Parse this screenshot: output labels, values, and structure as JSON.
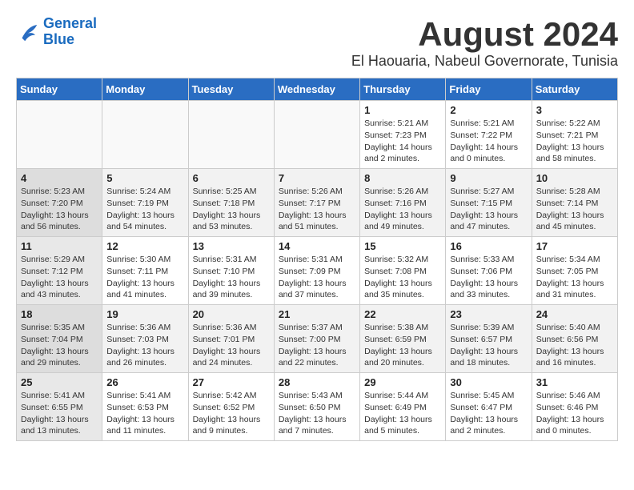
{
  "header": {
    "logo_line1": "General",
    "logo_line2": "Blue",
    "main_title": "August 2024",
    "subtitle": "El Haouaria, Nabeul Governorate, Tunisia"
  },
  "calendar": {
    "days_of_week": [
      "Sunday",
      "Monday",
      "Tuesday",
      "Wednesday",
      "Thursday",
      "Friday",
      "Saturday"
    ],
    "weeks": [
      {
        "days": [
          {
            "number": "",
            "content": ""
          },
          {
            "number": "",
            "content": ""
          },
          {
            "number": "",
            "content": ""
          },
          {
            "number": "",
            "content": ""
          },
          {
            "number": "1",
            "content": "Sunrise: 5:21 AM\nSunset: 7:23 PM\nDaylight: 14 hours\nand 2 minutes."
          },
          {
            "number": "2",
            "content": "Sunrise: 5:21 AM\nSunset: 7:22 PM\nDaylight: 14 hours\nand 0 minutes."
          },
          {
            "number": "3",
            "content": "Sunrise: 5:22 AM\nSunset: 7:21 PM\nDaylight: 13 hours\nand 58 minutes."
          }
        ]
      },
      {
        "days": [
          {
            "number": "4",
            "content": "Sunrise: 5:23 AM\nSunset: 7:20 PM\nDaylight: 13 hours\nand 56 minutes."
          },
          {
            "number": "5",
            "content": "Sunrise: 5:24 AM\nSunset: 7:19 PM\nDaylight: 13 hours\nand 54 minutes."
          },
          {
            "number": "6",
            "content": "Sunrise: 5:25 AM\nSunset: 7:18 PM\nDaylight: 13 hours\nand 53 minutes."
          },
          {
            "number": "7",
            "content": "Sunrise: 5:26 AM\nSunset: 7:17 PM\nDaylight: 13 hours\nand 51 minutes."
          },
          {
            "number": "8",
            "content": "Sunrise: 5:26 AM\nSunset: 7:16 PM\nDaylight: 13 hours\nand 49 minutes."
          },
          {
            "number": "9",
            "content": "Sunrise: 5:27 AM\nSunset: 7:15 PM\nDaylight: 13 hours\nand 47 minutes."
          },
          {
            "number": "10",
            "content": "Sunrise: 5:28 AM\nSunset: 7:14 PM\nDaylight: 13 hours\nand 45 minutes."
          }
        ]
      },
      {
        "days": [
          {
            "number": "11",
            "content": "Sunrise: 5:29 AM\nSunset: 7:12 PM\nDaylight: 13 hours\nand 43 minutes."
          },
          {
            "number": "12",
            "content": "Sunrise: 5:30 AM\nSunset: 7:11 PM\nDaylight: 13 hours\nand 41 minutes."
          },
          {
            "number": "13",
            "content": "Sunrise: 5:31 AM\nSunset: 7:10 PM\nDaylight: 13 hours\nand 39 minutes."
          },
          {
            "number": "14",
            "content": "Sunrise: 5:31 AM\nSunset: 7:09 PM\nDaylight: 13 hours\nand 37 minutes."
          },
          {
            "number": "15",
            "content": "Sunrise: 5:32 AM\nSunset: 7:08 PM\nDaylight: 13 hours\nand 35 minutes."
          },
          {
            "number": "16",
            "content": "Sunrise: 5:33 AM\nSunset: 7:06 PM\nDaylight: 13 hours\nand 33 minutes."
          },
          {
            "number": "17",
            "content": "Sunrise: 5:34 AM\nSunset: 7:05 PM\nDaylight: 13 hours\nand 31 minutes."
          }
        ]
      },
      {
        "days": [
          {
            "number": "18",
            "content": "Sunrise: 5:35 AM\nSunset: 7:04 PM\nDaylight: 13 hours\nand 29 minutes."
          },
          {
            "number": "19",
            "content": "Sunrise: 5:36 AM\nSunset: 7:03 PM\nDaylight: 13 hours\nand 26 minutes."
          },
          {
            "number": "20",
            "content": "Sunrise: 5:36 AM\nSunset: 7:01 PM\nDaylight: 13 hours\nand 24 minutes."
          },
          {
            "number": "21",
            "content": "Sunrise: 5:37 AM\nSunset: 7:00 PM\nDaylight: 13 hours\nand 22 minutes."
          },
          {
            "number": "22",
            "content": "Sunrise: 5:38 AM\nSunset: 6:59 PM\nDaylight: 13 hours\nand 20 minutes."
          },
          {
            "number": "23",
            "content": "Sunrise: 5:39 AM\nSunset: 6:57 PM\nDaylight: 13 hours\nand 18 minutes."
          },
          {
            "number": "24",
            "content": "Sunrise: 5:40 AM\nSunset: 6:56 PM\nDaylight: 13 hours\nand 16 minutes."
          }
        ]
      },
      {
        "days": [
          {
            "number": "25",
            "content": "Sunrise: 5:41 AM\nSunset: 6:55 PM\nDaylight: 13 hours\nand 13 minutes."
          },
          {
            "number": "26",
            "content": "Sunrise: 5:41 AM\nSunset: 6:53 PM\nDaylight: 13 hours\nand 11 minutes."
          },
          {
            "number": "27",
            "content": "Sunrise: 5:42 AM\nSunset: 6:52 PM\nDaylight: 13 hours\nand 9 minutes."
          },
          {
            "number": "28",
            "content": "Sunrise: 5:43 AM\nSunset: 6:50 PM\nDaylight: 13 hours\nand 7 minutes."
          },
          {
            "number": "29",
            "content": "Sunrise: 5:44 AM\nSunset: 6:49 PM\nDaylight: 13 hours\nand 5 minutes."
          },
          {
            "number": "30",
            "content": "Sunrise: 5:45 AM\nSunset: 6:47 PM\nDaylight: 13 hours\nand 2 minutes."
          },
          {
            "number": "31",
            "content": "Sunrise: 5:46 AM\nSunset: 6:46 PM\nDaylight: 13 hours\nand 0 minutes."
          }
        ]
      }
    ]
  }
}
